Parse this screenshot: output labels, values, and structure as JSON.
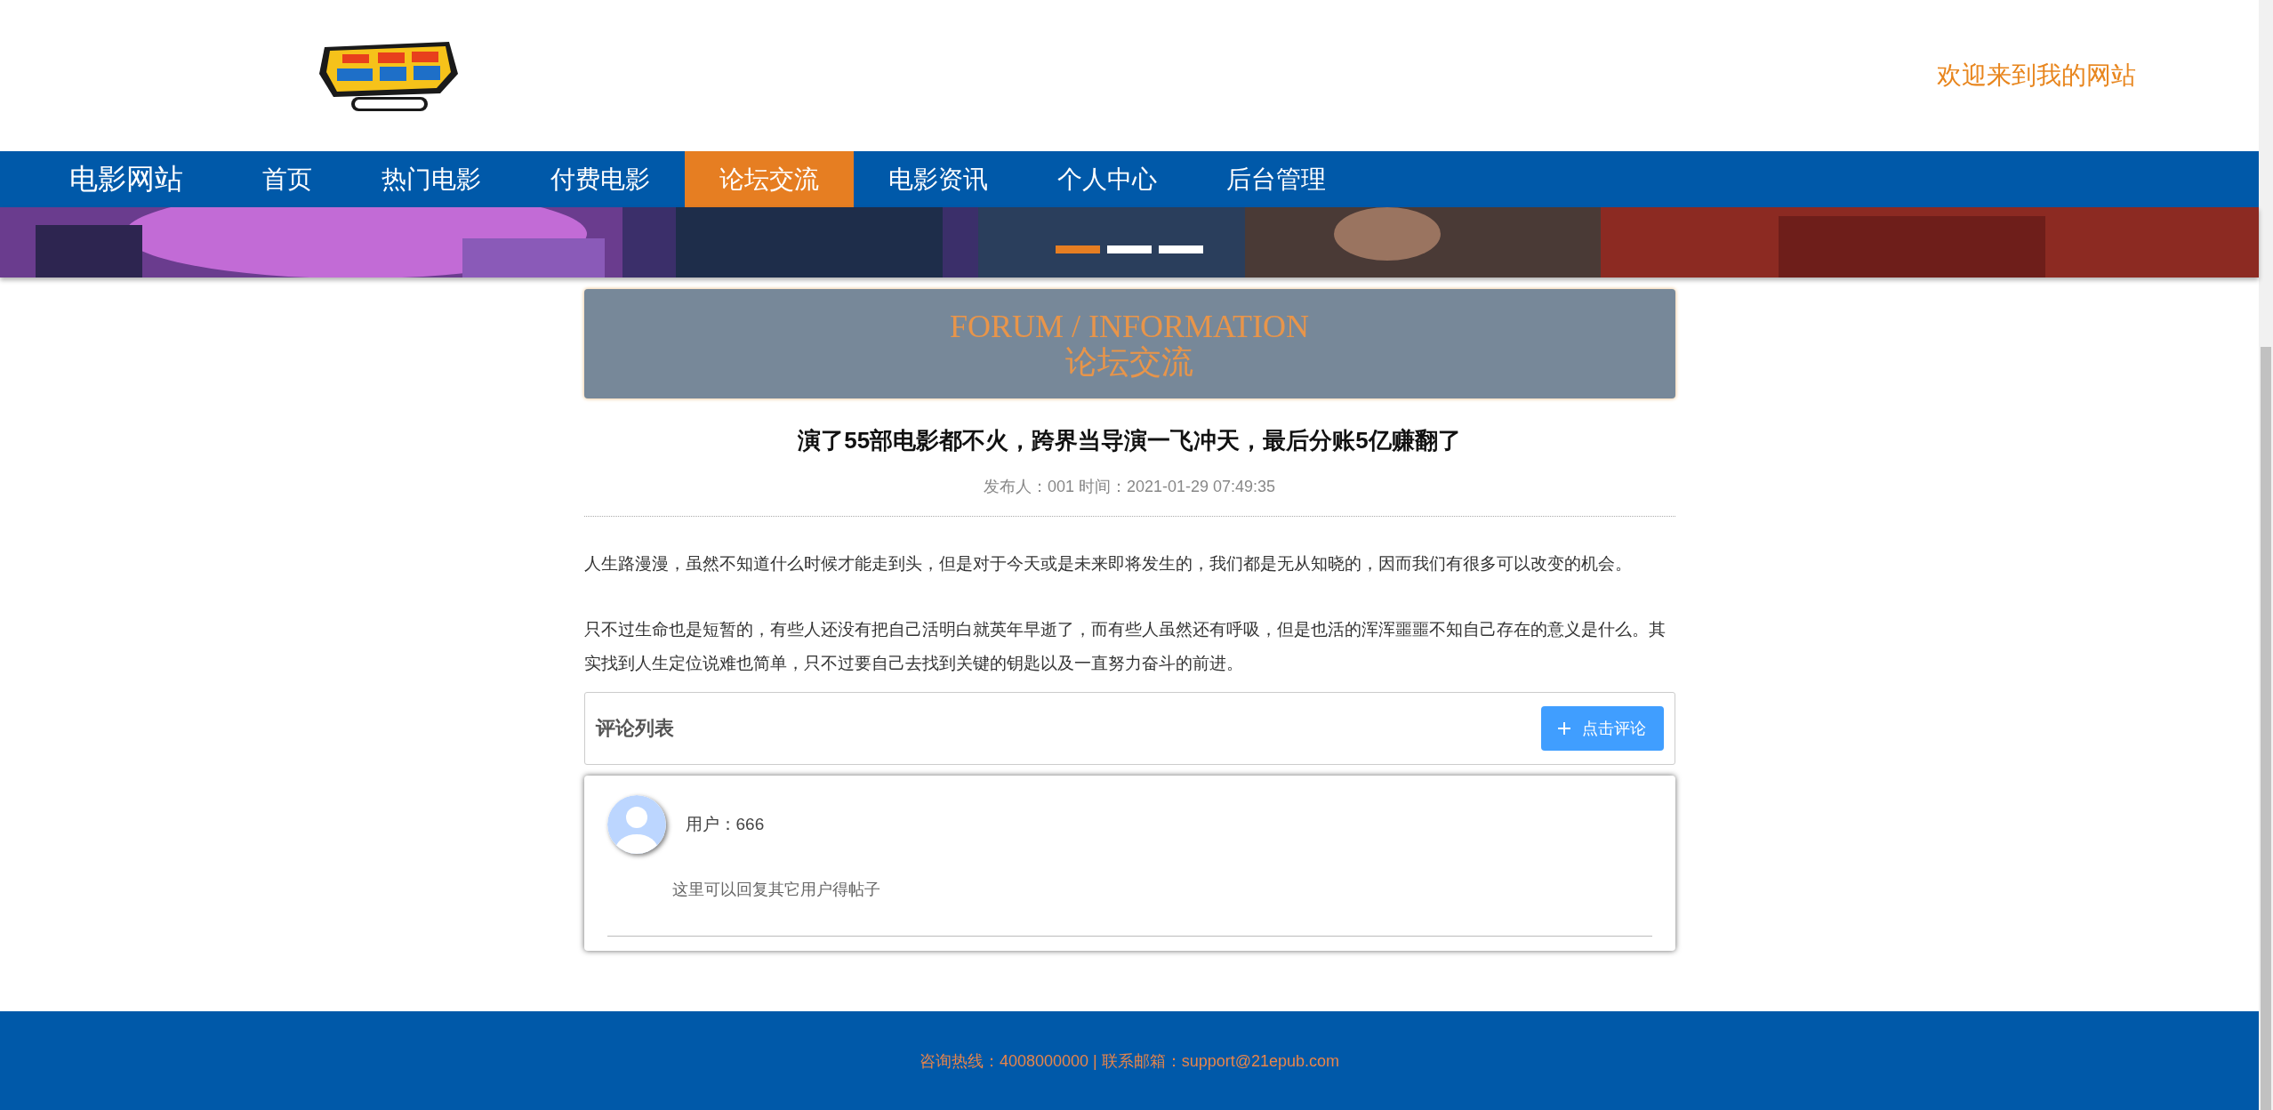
{
  "header": {
    "welcome": "欢迎来到我的网站"
  },
  "nav": {
    "brand": "电影网站",
    "items": [
      {
        "label": "首页",
        "selected": false
      },
      {
        "label": "热门电影",
        "selected": false
      },
      {
        "label": "付费电影",
        "selected": false
      },
      {
        "label": "论坛交流",
        "selected": true
      },
      {
        "label": "电影资讯",
        "selected": false
      },
      {
        "label": "个人中心",
        "selected": false
      },
      {
        "label": "后台管理",
        "selected": false
      }
    ]
  },
  "banner": {
    "kind": "picture",
    "dots": [
      {
        "selected": true
      },
      {
        "selected": false
      },
      {
        "selected": false
      }
    ]
  },
  "section_header": {
    "title_en": "FORUM / INFORMATION",
    "title_zh": "论坛交流"
  },
  "article": {
    "title": "演了55部电影都不火，跨界当导演一飞冲天，最后分账5亿赚翻了",
    "meta": "发布人：001 时间：2021-01-29 07:49:35",
    "paragraphs": [
      "人生路漫漫，虽然不知道什么时候才能走到头，但是对于今天或是未来即将发生的，我们都是无从知晓的，因而我们有很多可以改变的机会。",
      "只不过生命也是短暂的，有些人还没有把自己活明白就英年早逝了，而有些人虽然还有呼吸，但是也活的浑浑噩噩不知自己存在的意义是什么。其实找到人生定位说难也简单，只不过要自己去找到关键的钥匙以及一直努力奋斗的前进。"
    ]
  },
  "comments": {
    "heading": "评论列表",
    "button": "点击评论",
    "items": [
      {
        "user": "用户：666",
        "text": "这里可以回复其它用户得帖子"
      }
    ]
  },
  "footer": {
    "text": "咨询热线：4008000000 | 联系邮箱：support@21epub.com"
  }
}
